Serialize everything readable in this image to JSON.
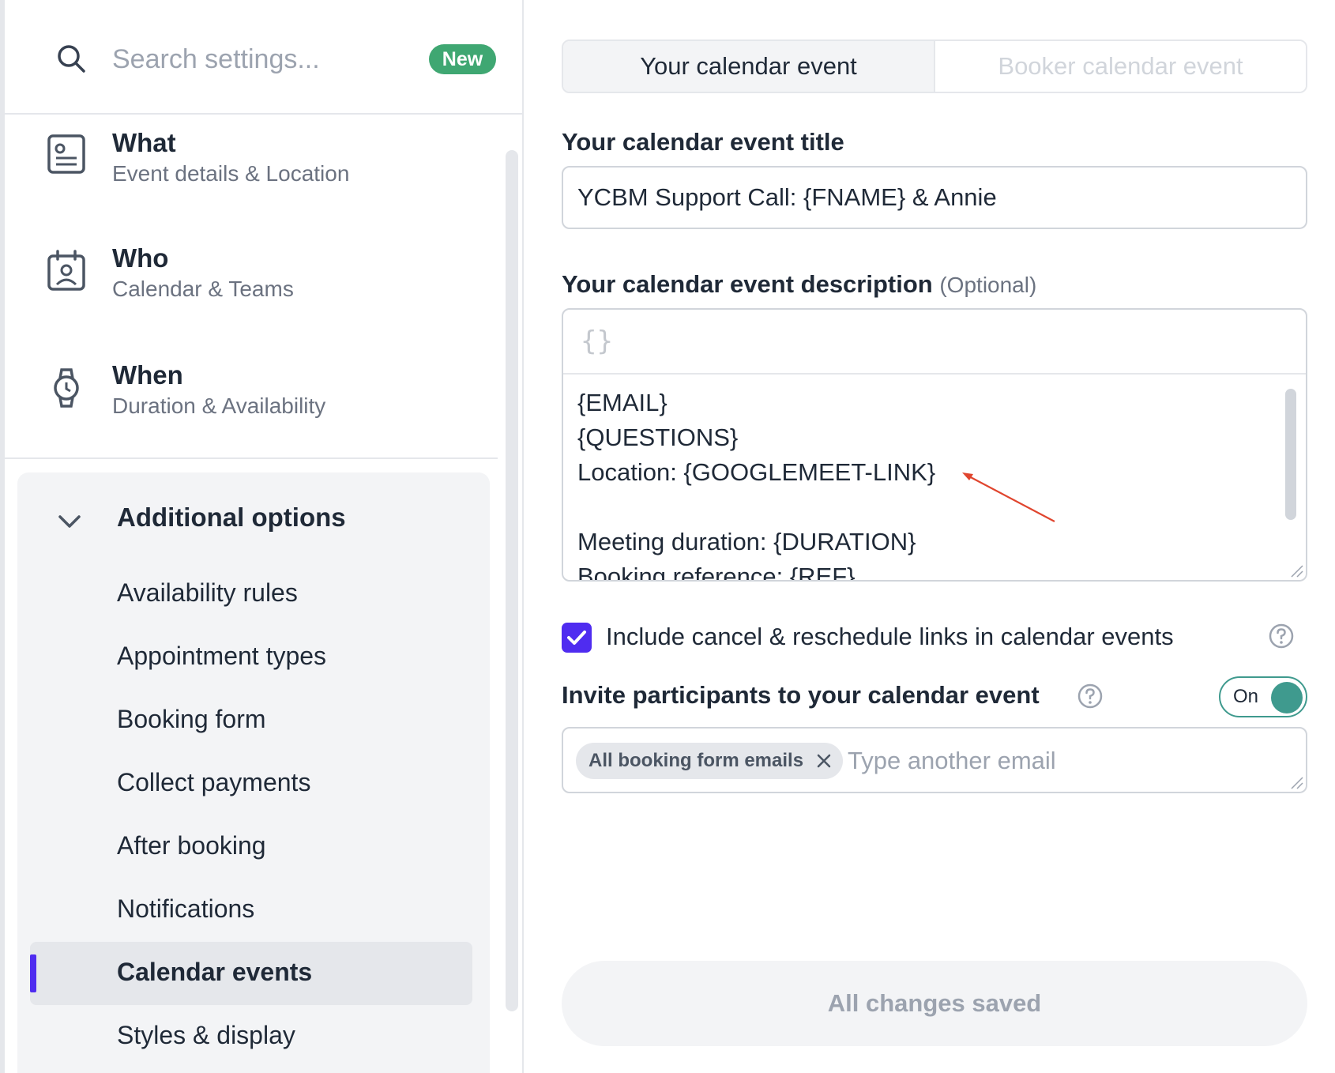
{
  "search": {
    "placeholder": "Search settings...",
    "badge": "New"
  },
  "nav": {
    "what": {
      "title": "What",
      "subtitle": "Event details & Location",
      "icon": "id-card-icon"
    },
    "who": {
      "title": "Who",
      "subtitle": "Calendar & Teams",
      "icon": "calendar-person-icon"
    },
    "when": {
      "title": "When",
      "subtitle": "Duration & Availability",
      "icon": "watch-icon"
    }
  },
  "additional": {
    "title": "Additional options",
    "items": [
      {
        "label": "Availability rules"
      },
      {
        "label": "Appointment types"
      },
      {
        "label": "Booking form"
      },
      {
        "label": "Collect payments"
      },
      {
        "label": "After booking"
      },
      {
        "label": "Notifications"
      },
      {
        "label": "Calendar events",
        "active": true
      },
      {
        "label": "Styles & display"
      }
    ]
  },
  "tabs": {
    "active": "Your calendar event",
    "inactive": "Booker calendar event"
  },
  "event_title": {
    "label": "Your calendar event title",
    "value": "YCBM Support Call: {FNAME} & Annie"
  },
  "description": {
    "label": "Your calendar event description",
    "optional": "(Optional)",
    "toolbar_button": "{}",
    "lines": [
      "{EMAIL}",
      "{QUESTIONS}",
      "Location: {GOOGLEMEET-LINK}",
      "",
      "Meeting duration: {DURATION}",
      "Booking reference: {REF}"
    ]
  },
  "include_links": {
    "label": "Include cancel & reschedule links in calendar events",
    "checked": true
  },
  "invite": {
    "label": "Invite participants to your calendar event",
    "toggle": "On",
    "chip": "All booking form emails",
    "placeholder": "Type another email"
  },
  "save": {
    "label": "All changes saved"
  },
  "colors": {
    "accent": "#4f2cf0",
    "toggle": "#3f9a8e",
    "badge": "#3fa772",
    "annotation": "#e0452e"
  }
}
